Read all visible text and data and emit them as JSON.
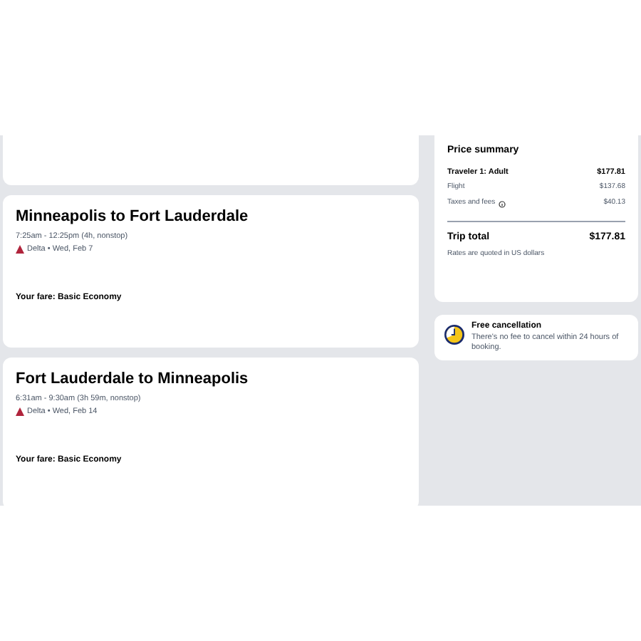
{
  "flights": [
    {
      "route": "Minneapolis to Fort Lauderdale",
      "times": "7:25am - 12:25pm (4h, nonstop)",
      "airline": "Delta • Wed, Feb 7",
      "fare": "Your fare: Basic Economy"
    },
    {
      "route": "Fort Lauderdale to Minneapolis",
      "times": "6:31am - 9:30am (3h 59m, nonstop)",
      "airline": "Delta • Wed, Feb 14",
      "fare": "Your fare: Basic Economy"
    }
  ],
  "price_summary": {
    "title": "Price summary",
    "lines": [
      {
        "kind": "header",
        "label": "Traveler 1: Adult",
        "amount": "$177.81"
      },
      {
        "kind": "line",
        "label": "Flight",
        "amount": "$137.68"
      },
      {
        "kind": "info",
        "label": "Taxes and fees",
        "amount": "$40.13"
      }
    ],
    "total_label": "Trip total",
    "total": "$177.81",
    "note": "Rates are quoted in US dollars"
  },
  "cancellation": {
    "title": "Free cancellation",
    "text": "There's no fee to cancel within 24 hours of booking."
  }
}
